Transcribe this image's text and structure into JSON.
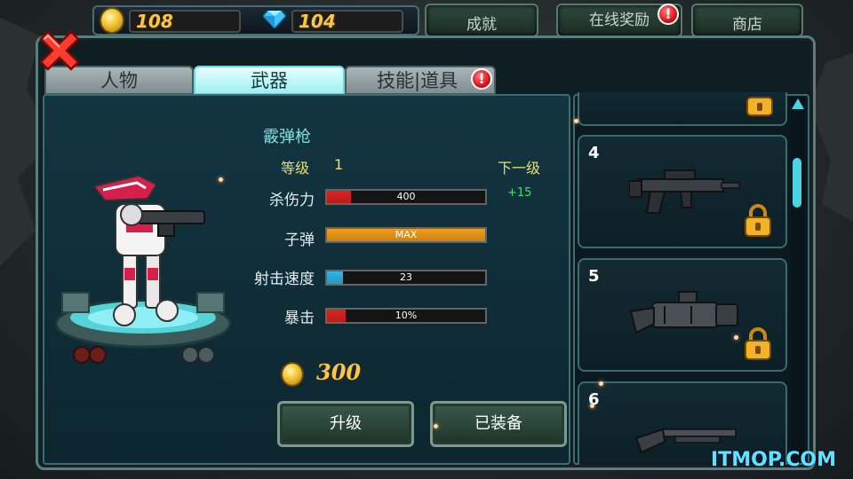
{
  "resources": {
    "coins": "108",
    "gems": "104"
  },
  "top_buttons": {
    "achievements": "成就",
    "online_reward": "在线奖励",
    "online_reward_alert": "!",
    "shop": "商店"
  },
  "tabs": {
    "character": "人物",
    "weapon": "武器",
    "skills_items": "技能|道具",
    "skills_items_alert": "!"
  },
  "weapon": {
    "name": "霰弹枪",
    "level_label": "等级",
    "level_value": "1",
    "next_level_label": "下一级",
    "stats": [
      {
        "label": "杀伤力",
        "value": "400",
        "fill": 0.15,
        "color": "#e0211d",
        "bonus": "+15"
      },
      {
        "label": "子弹",
        "value": "MAX",
        "fill": 1.0,
        "color": "#f59c18"
      },
      {
        "label": "射击速度",
        "value": "23",
        "fill": 0.1,
        "color": "#2fb6ea"
      },
      {
        "label": "暴击",
        "value": "10%",
        "fill": 0.12,
        "color": "#e0211d"
      }
    ],
    "upgrade_cost": "300"
  },
  "buttons": {
    "upgrade": "升级",
    "equipped": "已装备"
  },
  "weapon_slots": [
    {
      "number": "4",
      "locked": true,
      "icon": "assault-rifle-icon"
    },
    {
      "number": "5",
      "locked": true,
      "icon": "rocket-cannon-icon"
    },
    {
      "number": "6",
      "locked": false,
      "icon": "shotgun-icon"
    }
  ],
  "watermark": "ITMOP.COM"
}
